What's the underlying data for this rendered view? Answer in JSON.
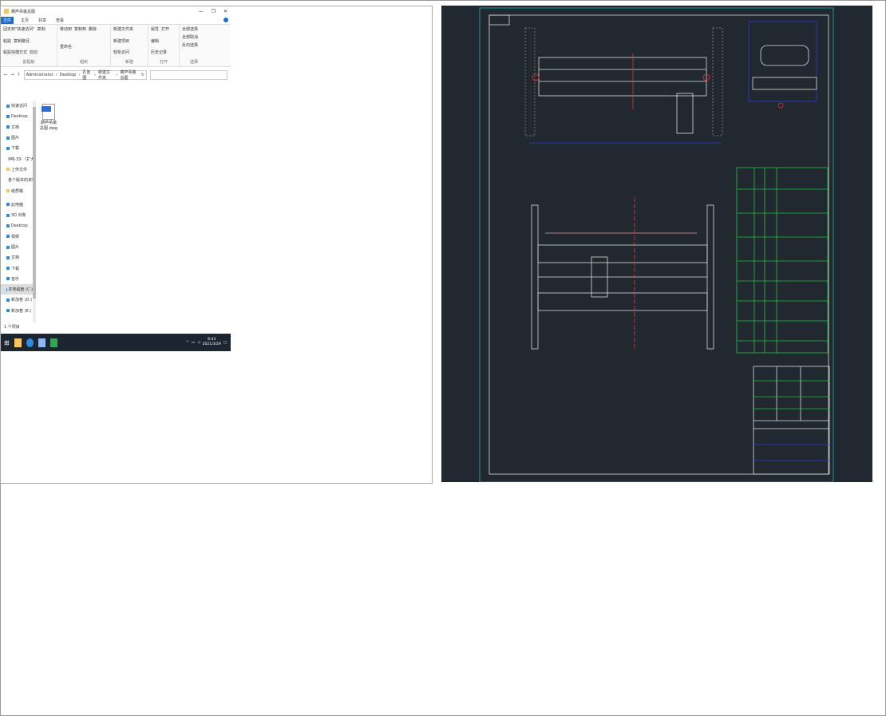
{
  "window": {
    "title": "葫芦吊装总图",
    "controls": [
      "—",
      "❐",
      "✕"
    ]
  },
  "tabs": [
    "文件",
    "主页",
    "共享",
    "查看"
  ],
  "ribbon": {
    "groups": [
      {
        "label": "剪贴板",
        "items": [
          "固定到\"快速访问\"",
          "复制",
          "粘贴",
          "复制路径",
          "粘贴快捷方式",
          "剪切"
        ]
      },
      {
        "label": "组织",
        "items": [
          "移动到",
          "复制到",
          "删除",
          "重命名"
        ]
      },
      {
        "label": "新建",
        "items": [
          "新建文件夹",
          "新建项目",
          "轻松访问"
        ]
      },
      {
        "label": "打开",
        "items": [
          "属性",
          "打开",
          "编辑",
          "历史记录"
        ]
      },
      {
        "label": "选择",
        "items": [
          "全部选择",
          "全部取消",
          "反向选择"
        ]
      }
    ]
  },
  "address": {
    "path": [
      "Administrator",
      "Desktop",
      "孔雀图",
      "新建文件夹",
      "葫芦吊装总图"
    ]
  },
  "sidebar": [
    "快速访问",
    "Desktop",
    "文档",
    "图片",
    "下载",
    "9吨-33-（扩大）",
    "上传文件",
    "各个版本的资料",
    "纸质稿",
    "此电脑",
    "3D 对象",
    "Desktop",
    "视频",
    "图片",
    "文档",
    "下载",
    "音乐",
    "本地磁盘 (C:)",
    "新加卷 (D:)",
    "新加卷 (E:)"
  ],
  "file": {
    "name": "葫芦吊装总图.dwg",
    "badge": "DWG"
  },
  "status": "1 个项目",
  "taskbar": {
    "time": "8:43",
    "date": "2021/3/29"
  },
  "colors": {
    "cad_bg": "#212830",
    "frame": "#1fb5b5",
    "table": "#22c33a",
    "dim": "#2a3bd8",
    "accent": "#1a6fc9"
  }
}
